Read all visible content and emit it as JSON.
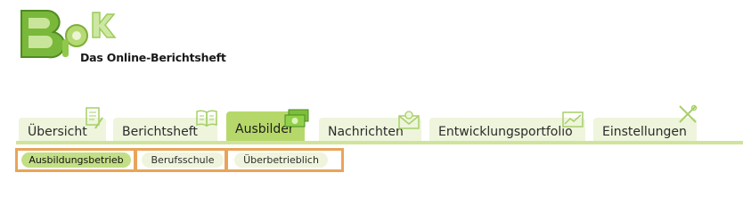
{
  "header": {
    "logo_text": "BOK",
    "tagline": "Das Online-Berichtsheft"
  },
  "tabs": [
    {
      "label": "Übersicht",
      "icon": "notepad-pencil-icon",
      "active": false
    },
    {
      "label": "Berichtsheft",
      "icon": "open-book-icon",
      "active": false
    },
    {
      "label": "Ausbilder",
      "icon": "money-bill-icon",
      "active": true
    },
    {
      "label": "Nachrichten",
      "icon": "envelope-at-icon",
      "active": false
    },
    {
      "label": "Entwicklungsportfolio",
      "icon": "chart-trend-icon",
      "active": false
    },
    {
      "label": "Einstellungen",
      "icon": "tools-icon",
      "active": false
    }
  ],
  "subnav": [
    {
      "label": "Ausbildungsbetrieb",
      "active": true
    },
    {
      "label": "Berufsschule",
      "active": false
    },
    {
      "label": "Überbetrieblich",
      "active": false
    }
  ],
  "colors": {
    "tab_bg": "#eef5dc",
    "tab_active": "#b6d86a",
    "underline": "#cfe49a",
    "highlight_box": "#e8a45a",
    "logo_green": "#7fbf3f"
  }
}
